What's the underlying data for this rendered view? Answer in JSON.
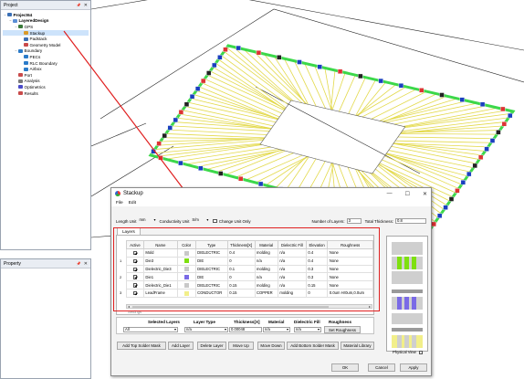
{
  "project_panel": {
    "title": "Project",
    "pin": "📌",
    "close": "✕",
    "tree": [
      {
        "label": "Project64",
        "bold": true,
        "indent": 0,
        "twisty": "−",
        "icon": "#3a6fb5"
      },
      {
        "label": "LayeredDesign",
        "bold": true,
        "indent": 1,
        "twisty": "−",
        "icon": "#5b8fd6"
      },
      {
        "label": "GPS",
        "bold": false,
        "indent": 2,
        "twisty": "−",
        "icon": "#3a7a3a"
      },
      {
        "label": "Stackup",
        "bold": false,
        "indent": 3,
        "twisty": "",
        "icon": "#d99a2b",
        "selected": true
      },
      {
        "label": "Padstack",
        "bold": false,
        "indent": 3,
        "twisty": "",
        "icon": "#3a6fb5"
      },
      {
        "label": "Geometry Model",
        "bold": false,
        "indent": 3,
        "twisty": "",
        "icon": "#c94a4a"
      },
      {
        "label": "Boundary",
        "bold": false,
        "indent": 2,
        "twisty": "−",
        "icon": "#2b7bc9"
      },
      {
        "label": "PECs",
        "bold": false,
        "indent": 3,
        "twisty": "",
        "icon": "#2b7bc9"
      },
      {
        "label": "RLC Boundary",
        "bold": false,
        "indent": 3,
        "twisty": "",
        "icon": "#2b7bc9"
      },
      {
        "label": "Airbox",
        "bold": false,
        "indent": 3,
        "twisty": "",
        "icon": "#2b7bc9"
      },
      {
        "label": "Port",
        "bold": false,
        "indent": 2,
        "twisty": "",
        "icon": "#c94a4a"
      },
      {
        "label": "Analysis",
        "bold": false,
        "indent": 2,
        "twisty": "",
        "icon": "#7a7a7a"
      },
      {
        "label": "Optimetrics",
        "bold": false,
        "indent": 2,
        "twisty": "",
        "icon": "#4a4ac9"
      },
      {
        "label": "Results",
        "bold": false,
        "indent": 2,
        "twisty": "",
        "icon": "#c94a4a"
      }
    ]
  },
  "property_panel": {
    "title": "Property",
    "pin": "📌",
    "close": "✕"
  },
  "dialog": {
    "title": "Stackup",
    "minimize": "—",
    "maximize": "☐",
    "close": "✕",
    "menu": [
      "File",
      "Edit"
    ],
    "length_unit_label": "Length Unit",
    "length_unit_value": "mm",
    "conductivity_unit_label": "Conductivity Unit",
    "conductivity_unit_value": "S/m",
    "change_unit_only_label": "Change Unit Only",
    "num_layers_label": "Number of Layers:",
    "num_layers_value": "3",
    "total_thickness_label": "Total Thickness:",
    "total_thickness_value": "0.8",
    "tab_layers": "Layers",
    "columns": [
      "Active",
      "Name",
      "Color",
      "Type",
      "Thickness[X]",
      "Material",
      "Dielectric Fill",
      "Elevation",
      "Roughness"
    ],
    "rows": [
      {
        "num": "",
        "active": true,
        "name": "Mold",
        "color": "#c8c8c8",
        "type": "DIELECTRIC",
        "thickness": "0.4",
        "material": "molding",
        "fill": "n/a",
        "elevation": "0.4",
        "roughness": "None"
      },
      {
        "num": "1",
        "active": true,
        "name": "Die3",
        "color": "#7ee00f",
        "type": "DIE",
        "thickness": "0",
        "material": "n/a",
        "fill": "n/a",
        "elevation": "0.4",
        "roughness": "None"
      },
      {
        "num": "",
        "active": true,
        "name": "Dielectric_Die3",
        "color": "#c8c8c8",
        "type": "DIELECTRIC",
        "thickness": "0.1",
        "material": "molding",
        "fill": "n/a",
        "elevation": "0.3",
        "roughness": "None"
      },
      {
        "num": "2",
        "active": true,
        "name": "Die1",
        "color": "#7a6ae6",
        "type": "DIE",
        "thickness": "0",
        "material": "n/a",
        "fill": "n/a",
        "elevation": "0.3",
        "roughness": "None"
      },
      {
        "num": "",
        "active": true,
        "name": "Dielectric_Die1",
        "color": "#c8c8c8",
        "type": "DIELECTRIC",
        "thickness": "0.15",
        "material": "molding",
        "fill": "n/a",
        "elevation": "0.15",
        "roughness": "None"
      },
      {
        "num": "3",
        "active": true,
        "name": "LeadFrame",
        "color": "#f2ef8a",
        "type": "CONDUCTOR",
        "thickness": "0.15",
        "material": "COPPER",
        "fill": "molding",
        "elevation": "0",
        "roughness": "0.0um Hr0um,0.0um"
      }
    ],
    "settings_label": "Settings",
    "filter": {
      "selected_layers_label": "Selected Layers",
      "selected_layers_value": "All",
      "layer_type_label": "Layer Type",
      "layer_type_value": "n/a",
      "thickness_label": "Thickness[X]",
      "thickness_value": "0.00048",
      "material_label": "Material",
      "material_value": "n/a",
      "dielectric_fill_label": "Dielectric Fill",
      "dielectric_fill_value": "n/a",
      "roughness_label": "Roughness",
      "roughness_button": "Set Roughness"
    },
    "actions": [
      "Add Top Solder Mask",
      "Add Layer",
      "Delete Layer",
      "Move Up",
      "Move Down",
      "Add Bottom Solder Mask",
      "Material Library"
    ],
    "physical_view_label": "Physical View",
    "ok": "OK",
    "cancel": "Cancel",
    "apply": "Apply"
  },
  "colors": {
    "accent_red": "#e02020",
    "wire_yellow": "#e3d94a",
    "pad_green": "#3cd84a"
  }
}
